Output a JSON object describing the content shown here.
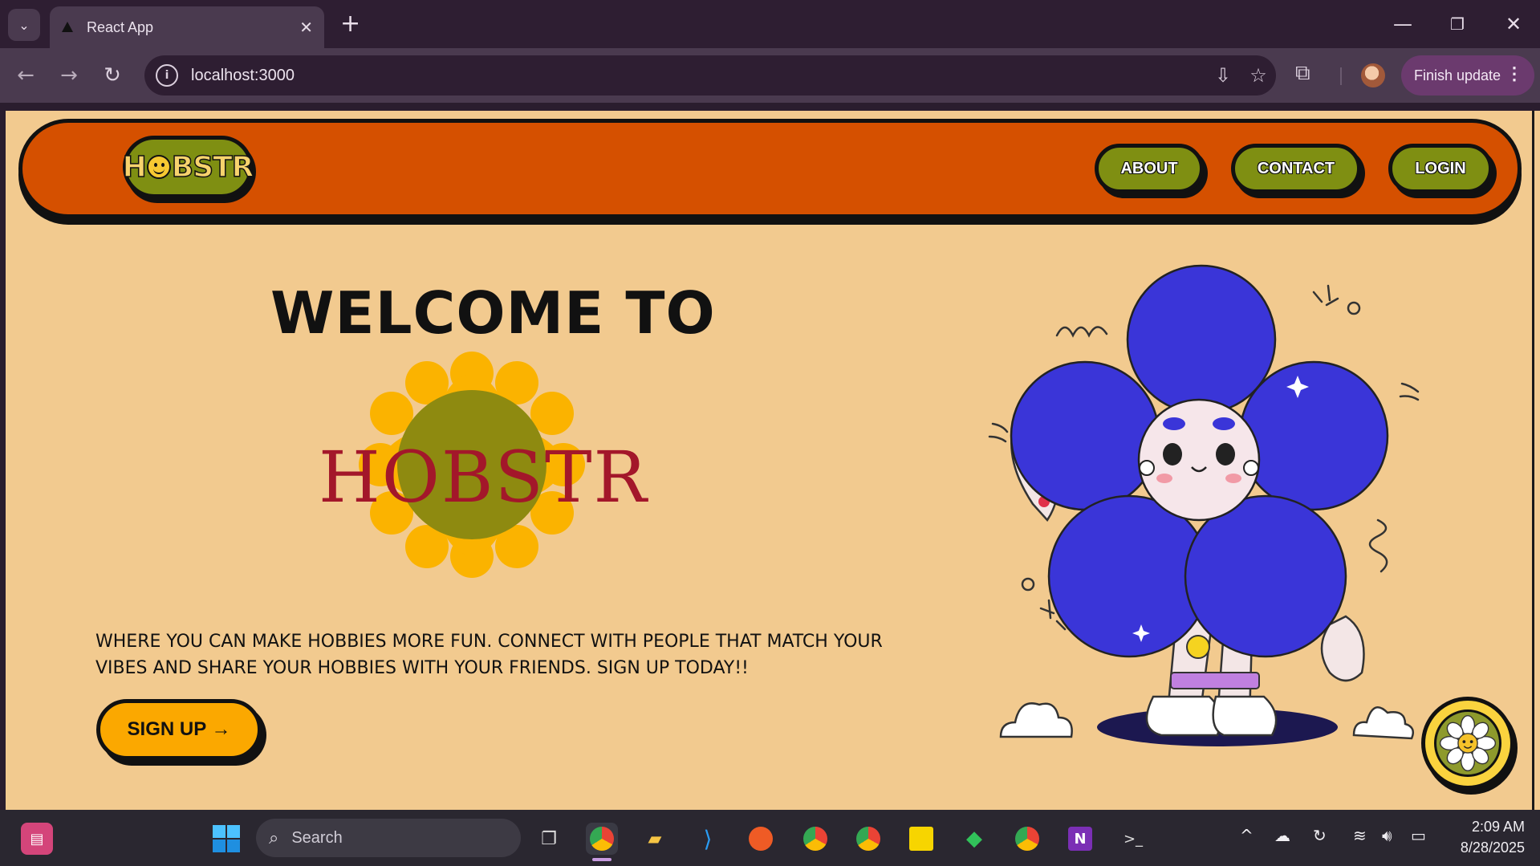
{
  "browser": {
    "tab_title": "React App",
    "url": "localhost:3000",
    "finish_update_label": "Finish update"
  },
  "navbar": {
    "logo_left": "H",
    "logo_right": "BSTR",
    "links": [
      {
        "label": "ABOUT"
      },
      {
        "label": "CONTACT"
      },
      {
        "label": "LOGIN"
      }
    ]
  },
  "hero": {
    "heading": "WELCOME TO",
    "brand": "HOBSTR",
    "tagline": "WHERE YOU CAN MAKE HOBBIES MORE FUN. CONNECT WITH PEOPLE THAT MATCH YOUR VIBES AND SHARE YOUR HOBBIES WITH YOUR FRIENDS. SIGN UP TODAY!!",
    "signup_label": "SIGN UP →"
  },
  "taskbar": {
    "search_placeholder": "Search",
    "time": "2:09 AM",
    "date": "8/28/2025"
  },
  "colors": {
    "page_bg": "#f2ca8f",
    "navbar_bg": "#d55000",
    "button_green": "#7f8f12",
    "signup_orange": "#fba800",
    "brand_red": "#a3172a",
    "flower_blue": "#3a35d8"
  }
}
